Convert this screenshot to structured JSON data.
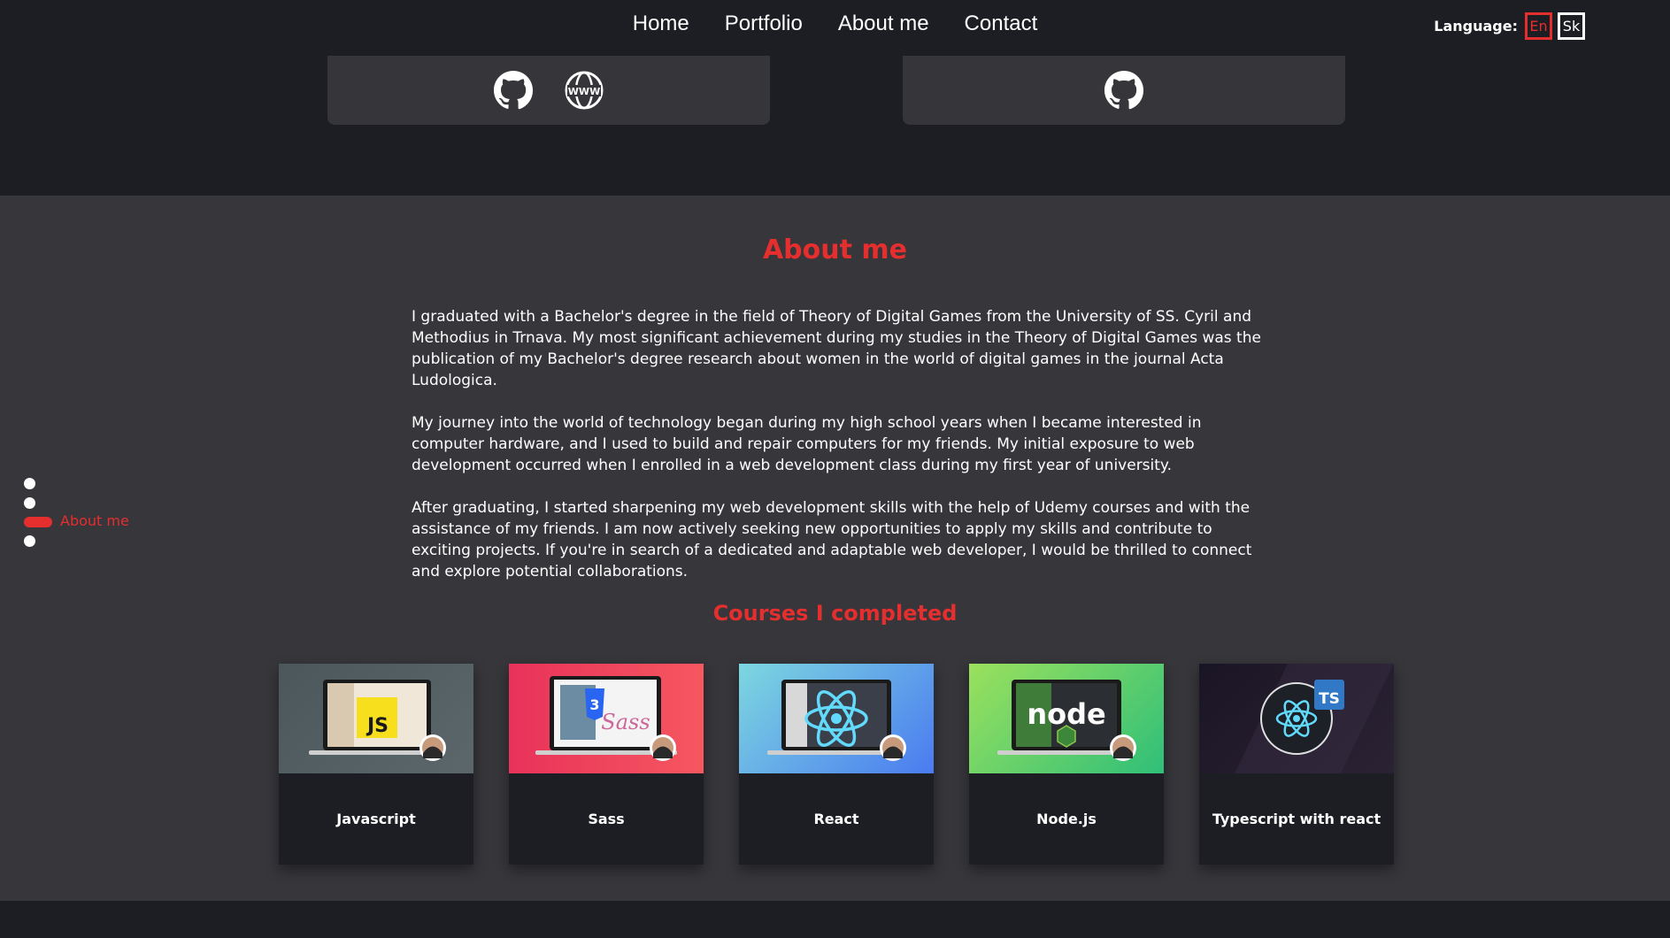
{
  "nav": {
    "items": [
      "Home",
      "Portfolio",
      "About me",
      "Contact"
    ],
    "language_label": "Language:",
    "languages": [
      "En",
      "Sk"
    ],
    "active_language": "En"
  },
  "portfolio_cards": [
    {
      "icons": [
        "github-icon",
        "www-icon"
      ]
    },
    {
      "icons": [
        "github-icon"
      ]
    }
  ],
  "about": {
    "title": "About me",
    "paragraphs": [
      "I graduated with a Bachelor's degree in the field of Theory of Digital Games from the University of SS. Cyril and Methodius in Trnava. My most significant achievement during my studies in the Theory of Digital Games was the publication of my Bachelor's degree research about women in the world of digital games in the journal Acta Ludologica.",
      "My journey into the world of technology began during my high school years when I became interested in computer hardware, and I used to build and repair computers for my friends. My initial exposure to web development occurred when I enrolled in a web development class during my first year of university.",
      "After graduating, I started sharpening my web development skills with the help of Udemy courses and with the assistance of my friends. I am now actively seeking new opportunities to apply my skills and contribute to exciting projects. If you're in search of a dedicated and adaptable web developer, I would be thrilled to connect and explore potential collaborations."
    ]
  },
  "courses": {
    "title": "Courses I completed",
    "items": [
      {
        "name": "Javascript",
        "badge": "JS"
      },
      {
        "name": "Sass",
        "badge": "Sass"
      },
      {
        "name": "React",
        "badge": ""
      },
      {
        "name": "Node.js",
        "badge": "node"
      },
      {
        "name": "Typescript with react",
        "badge": "TS"
      }
    ]
  },
  "side_nav": {
    "active_label": "About me",
    "active_index": 2
  },
  "colors": {
    "accent": "#e52e2e",
    "background": "#1d1e24",
    "section": "#36363b",
    "card": "#35353a"
  }
}
